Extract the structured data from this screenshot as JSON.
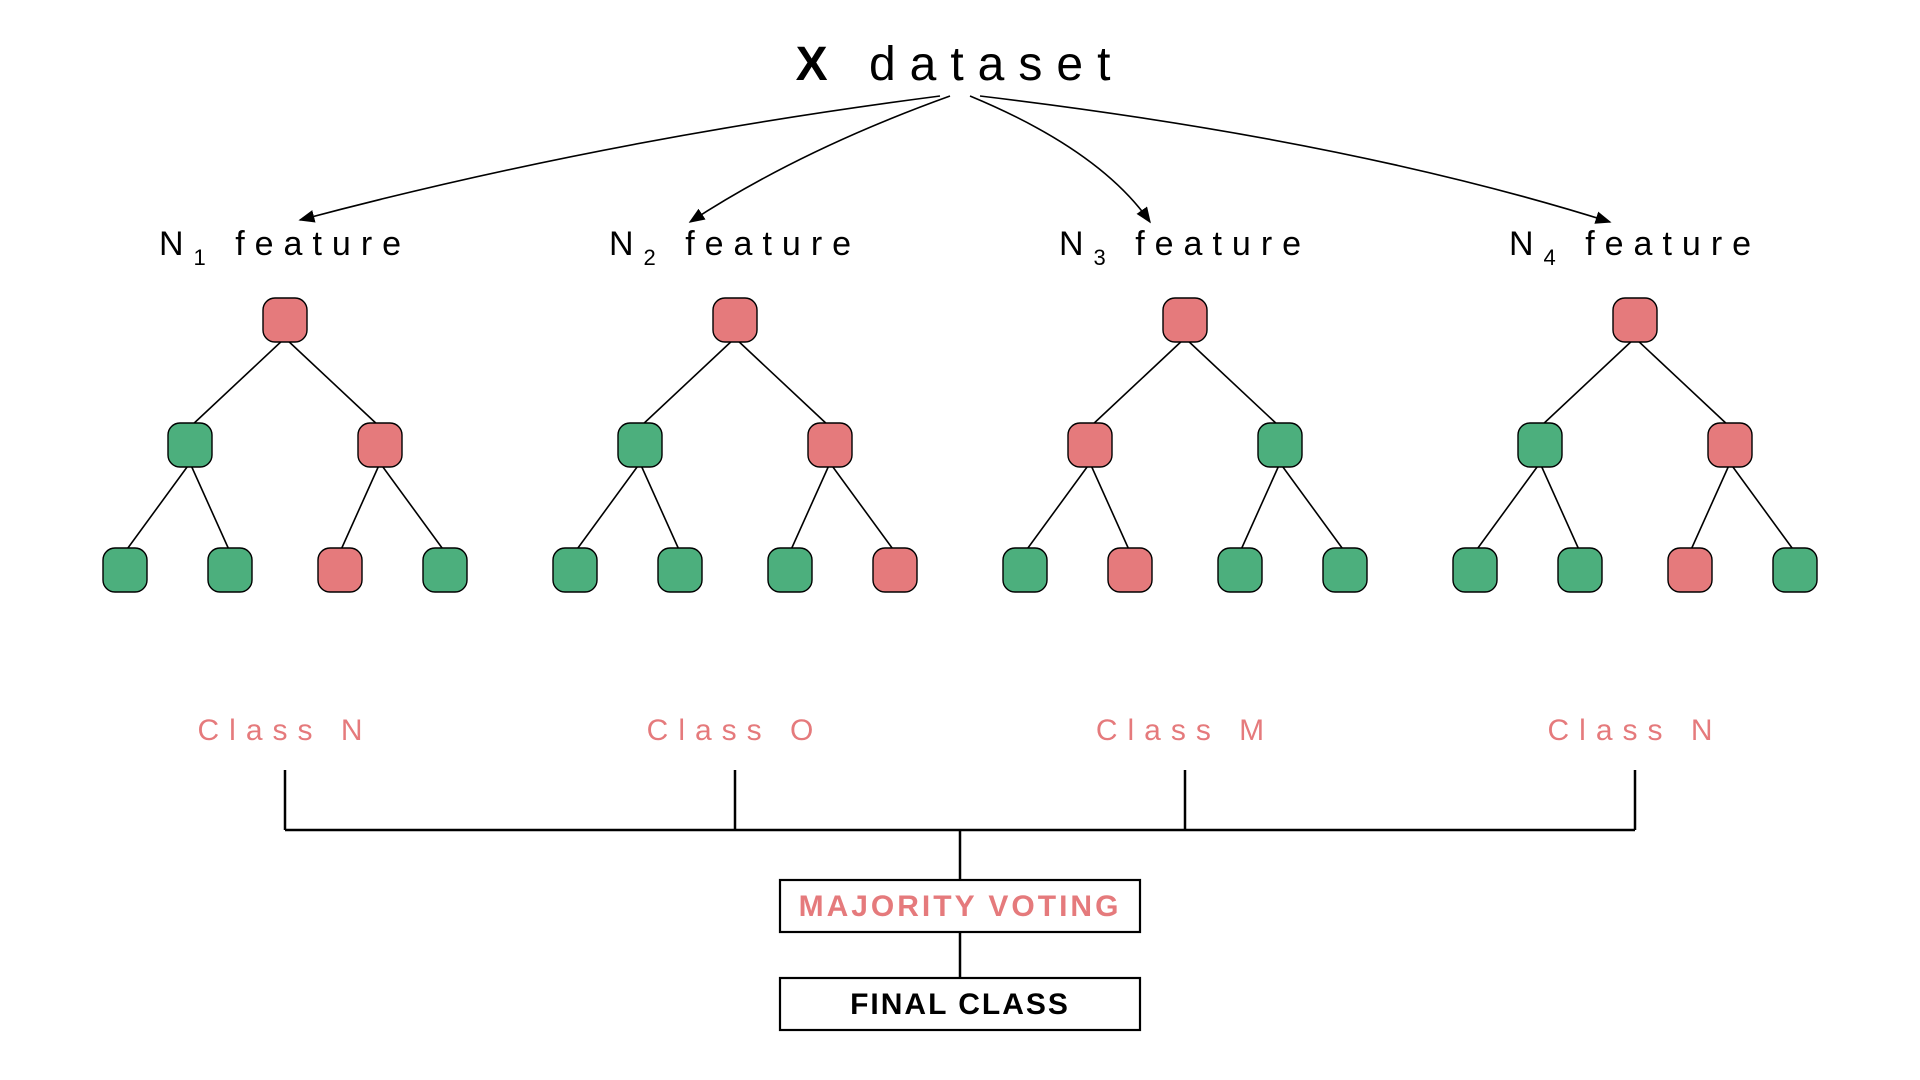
{
  "title_bold": "X",
  "title_rest": "dataset",
  "colors": {
    "node_red": "#e57a7c",
    "node_green": "#4caf7d",
    "accent_text": "#e57a7c"
  },
  "trees": [
    {
      "feature_prefix": "N",
      "feature_sub": "1",
      "feature_suffix": "feature",
      "class_label": "Class N",
      "nodes": [
        "red",
        "green",
        "red",
        "green",
        "green",
        "red",
        "green"
      ]
    },
    {
      "feature_prefix": "N",
      "feature_sub": "2",
      "feature_suffix": "feature",
      "class_label": "Class O",
      "nodes": [
        "red",
        "green",
        "red",
        "green",
        "green",
        "green",
        "red"
      ]
    },
    {
      "feature_prefix": "N",
      "feature_sub": "3",
      "feature_suffix": "feature",
      "class_label": "Class M",
      "nodes": [
        "red",
        "red",
        "green",
        "green",
        "red",
        "green",
        "green"
      ]
    },
    {
      "feature_prefix": "N",
      "feature_sub": "4",
      "feature_suffix": "feature",
      "class_label": "Class N",
      "nodes": [
        "red",
        "green",
        "red",
        "green",
        "green",
        "red",
        "green"
      ]
    }
  ],
  "vote_label": "MAJORITY VOTING",
  "final_label": "FINAL CLASS"
}
